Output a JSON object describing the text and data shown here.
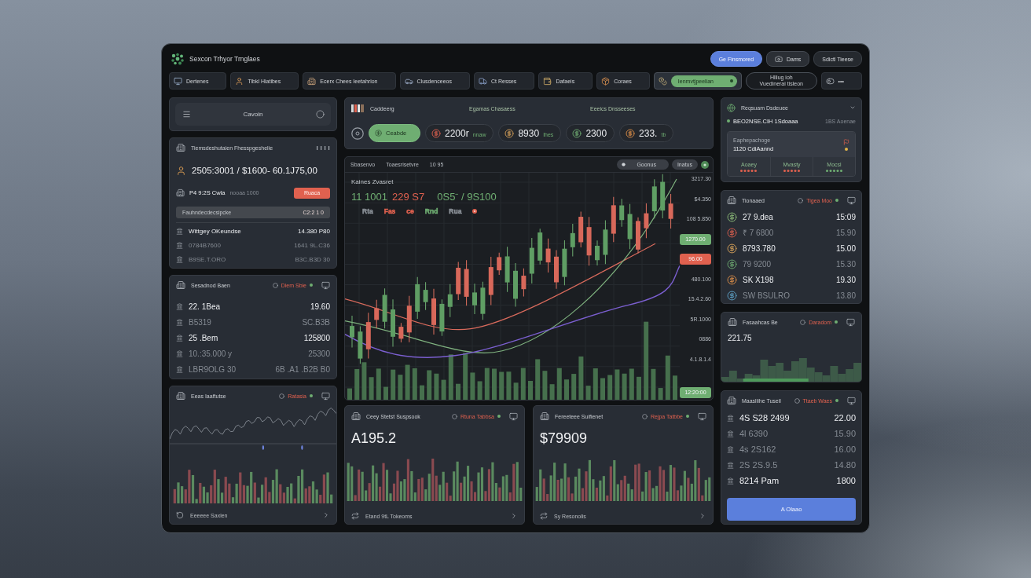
{
  "app": {
    "title": "Sexcon Trhyor Trnglaes"
  },
  "header_buttons": [
    {
      "kind": "primary",
      "label": "Ge Finsmored"
    },
    {
      "kind": "icon",
      "label": "Dams"
    },
    {
      "kind": "plain",
      "label": "Sdictl Tieese"
    }
  ],
  "nav": [
    {
      "kind": "tab",
      "label": "Dertenes",
      "selected": false
    },
    {
      "kind": "tab",
      "label": "Tibkl Hiatibes",
      "selected": false
    },
    {
      "kind": "tab",
      "label": "Ecerx Chees Ieetahrion",
      "selected": false
    },
    {
      "kind": "tab",
      "label": "Clusdenceeos",
      "selected": false
    },
    {
      "kind": "tab",
      "label": "Ct Resses",
      "selected": false
    },
    {
      "kind": "tab",
      "label": "Dafaeis",
      "selected": false
    },
    {
      "kind": "tab",
      "label": "Coraes",
      "selected": false
    },
    {
      "kind": "tab",
      "label": "Ienmvtjpeelian",
      "selected": true
    },
    {
      "kind": "stacked",
      "label": "Hlliug ioh",
      "sublabel": "Vuedinerai tisleon",
      "selected": false
    },
    {
      "kind": "more",
      "label": "•••",
      "selected": false
    }
  ],
  "search": {
    "placeholder": "Cavoin"
  },
  "summary": {
    "title": "Tiemsdeshutaien Fhesspgeshelie",
    "headline": "2505:3001 / $1600- 60.1J75,00",
    "order": {
      "label": "P4 9:2S Cwla",
      "note": "nooaa 1000",
      "button": "Ruaca"
    },
    "field": {
      "value": "Fauhndecdecsipcke",
      "reading": "C2:2 1 0"
    },
    "rows": [
      {
        "label": "Wittgey OKeundse",
        "value": "14.380 P80",
        "dimmed": false
      },
      {
        "label": "0784B7600",
        "value": "1641 9L.C36",
        "dimmed": true
      },
      {
        "label": "B9SE.T.ORO",
        "value": "B3C.B3D 30",
        "dimmed": true
      }
    ]
  },
  "watchlist": {
    "title": "Sesadnod Baen",
    "status": "Diem Sbie",
    "rows": [
      {
        "label": "22. 1Bea",
        "value": "19.60",
        "dimmed": false
      },
      {
        "label": "B5319",
        "value": "SC.B3B",
        "dimmed": true
      },
      {
        "label": "25 .Bem",
        "value": "125800",
        "dimmed": false
      },
      {
        "label": "10.:35.000 y",
        "value": "25300",
        "dimmed": true
      },
      {
        "label": "LBR9OLG 30",
        "value": "6B .A1 .B2B B0",
        "dimmed": true
      }
    ]
  },
  "trend": {
    "title": "Eeas Iaaftutse",
    "status": "Ratasia",
    "footer": "Eeeeee Saxlen"
  },
  "market": {
    "title": "Caddeerg",
    "links": [
      "Egamas Chasaess",
      "Eeeics Dnsseeses"
    ],
    "chips": [
      {
        "label": "Ceabde",
        "selected": true
      },
      {
        "label": "2200r",
        "note": "nnaw",
        "selected": false
      },
      {
        "label": "8930",
        "note": "Ihes",
        "selected": false
      },
      {
        "label": "2300",
        "selected": false
      },
      {
        "label": "233.",
        "note": "tb",
        "selected": false
      }
    ]
  },
  "chart": {
    "tabs": [
      "Sbasenvo",
      "Toaesrisetvre",
      "10 95"
    ],
    "controls": [
      "Goonus",
      "Inatus"
    ],
    "title": "Kaines Zvasret",
    "quotes": [
      {
        "text": "11 1001",
        "color": "#6fae72"
      },
      {
        "text": "229 S7",
        "color": "#e0614f"
      },
      {
        "text": "0S5⁻ / 9S100",
        "color": "#6fae72"
      }
    ],
    "legend": [
      {
        "text": "Rta",
        "color": "#8a9097"
      },
      {
        "text": "Fas",
        "color": "#e0614f"
      },
      {
        "text": "ce",
        "color": "#e0614f"
      },
      {
        "text": "Rnd",
        "color": "#6fae72"
      },
      {
        "text": "Rua",
        "color": "#8a9097"
      }
    ],
    "axis_labels": [
      {
        "kind": "label",
        "text": "3217.30"
      },
      {
        "kind": "label",
        "text": "$4.350"
      },
      {
        "kind": "label",
        "text": "108 5.850"
      },
      {
        "kind": "tag",
        "text": "1270.00",
        "color": "#6fae72"
      },
      {
        "kind": "tag",
        "text": "96.00",
        "color": "#e0614f"
      },
      {
        "kind": "label",
        "text": "480.100"
      },
      {
        "kind": "label",
        "text": "15.4.2.60"
      },
      {
        "kind": "label",
        "text": "5R.1000"
      },
      {
        "kind": "label",
        "text": "0886"
      },
      {
        "kind": "label",
        "text": "4.1.8.1.4"
      },
      {
        "kind": "tag",
        "text": "12:20:00",
        "color": "#6fae72"
      }
    ]
  },
  "cards": [
    {
      "title": "Ceey Stetst Suspsook",
      "status": "Rtuna Tabbsa",
      "value": "A195.2",
      "footer": "Etand 9tL Tokeoms"
    },
    {
      "title": "Fereeteee Suifienet",
      "status": "Rejpa Tatbbe",
      "value": "$79909",
      "footer": "Sy Resonolis"
    }
  ],
  "account": {
    "title": "Reqsuam Dsdeuee",
    "headline": "BEO2NSE.CIH 1Sdoaaa",
    "note": "1BS Aoenae",
    "detail_label": "Eaphepachoge",
    "detail_value": "1120 CdiAannd",
    "stats": [
      {
        "label": "Aoaey",
        "color": "#e0614f"
      },
      {
        "label": "Mvasty",
        "color": "#e0614f"
      },
      {
        "label": "Mocsl",
        "color": "#6fae72"
      }
    ]
  },
  "holdings": {
    "title": "Tionaaed",
    "status": "Tigea Moo",
    "rows": [
      {
        "label": "27 9.dea",
        "value": "15:09",
        "dimmed": false
      },
      {
        "label": "₹ 7 6800",
        "value": "15.90",
        "dimmed": true
      },
      {
        "label": "8793.780",
        "value": "15.00",
        "dimmed": false
      },
      {
        "label": "79 9200",
        "value": "15.30",
        "dimmed": true
      },
      {
        "label": "SK X198",
        "value": "19.30",
        "dimmed": false
      },
      {
        "label": "SW BSULRO",
        "value": "13.80",
        "dimmed": true
      }
    ]
  },
  "balance": {
    "title": "Fasaahcas Be",
    "status": "Daradom",
    "value": "221.75"
  },
  "orders": {
    "title": "Maasliihe Tuseil",
    "status": "Ttaeb Waes",
    "rows": [
      {
        "label": "4S S28 2499",
        "value": "22.00",
        "dimmed": false
      },
      {
        "label": "4l 6390",
        "value": "15.90",
        "dimmed": true
      },
      {
        "label": "4s 2S162",
        "value": "16.00",
        "dimmed": true
      },
      {
        "label": "2S 2S.9.5",
        "value": "14.80",
        "dimmed": true
      },
      {
        "label": "8214 Pam",
        "value": "1800",
        "dimmed": false
      }
    ],
    "button": "A Olaao"
  }
}
